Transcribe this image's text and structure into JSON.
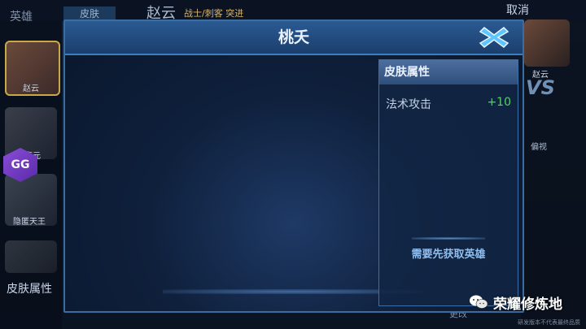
{
  "background": {
    "tabs": {
      "hero": "英雄",
      "active_tab": "皮肤"
    },
    "hero_header": {
      "name": "赵云",
      "subtitle": "战士/刺客 突进"
    },
    "cancel_label": "取消",
    "left_rail": {
      "labels": [
        "赵云",
        "李元",
        "隐匿天王"
      ],
      "bottom_label": "皮肤属性"
    },
    "right_rail": {
      "name": "赵云",
      "vs": "VS",
      "word": "偏视"
    },
    "bottom_button": "更改",
    "tiny_note": "研发版本不代表最终品质"
  },
  "modal": {
    "title": "桃夭",
    "close_icon": "close-x-icon"
  },
  "attr_panel": {
    "title": "皮肤属性",
    "rows": [
      {
        "name": "法术攻击",
        "value": "+10"
      }
    ],
    "notice": "需要先获取英雄"
  },
  "watermark": {
    "text": "荣耀修炼地",
    "icon": "wechat-icon"
  },
  "colors": {
    "header_blue": "#2a5a92",
    "accent_blue": "#8fbef0",
    "positive_green": "#54d06a",
    "close_cyan": "#5ec6ff"
  }
}
